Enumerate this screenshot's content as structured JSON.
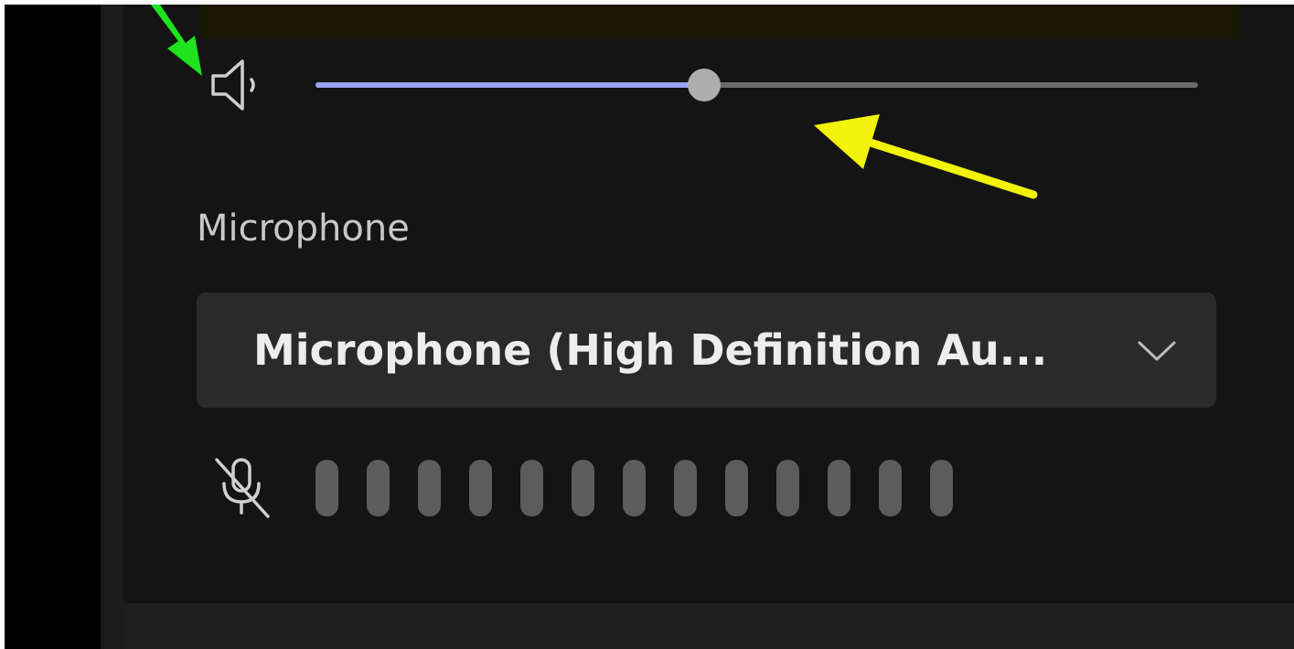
{
  "speaker": {
    "icon": "speaker-icon",
    "volume_percent": 44
  },
  "microphone": {
    "label": "Microphone",
    "selected_device": "Microphone (High Definition Au...",
    "dropdown_icon": "chevron-down-icon",
    "mute_icon": "mic-off-icon",
    "level_bar_count": 13
  },
  "annotations": {
    "green_arrow_color": "#1ee31e",
    "yellow_arrow_color": "#f2f20a"
  },
  "colors": {
    "slider_fill": "#9ba2f2",
    "slider_track": "#6a6a6a",
    "slider_thumb": "#adadad",
    "panel_bg": "#141414",
    "dropdown_bg": "#2a2a2a"
  }
}
